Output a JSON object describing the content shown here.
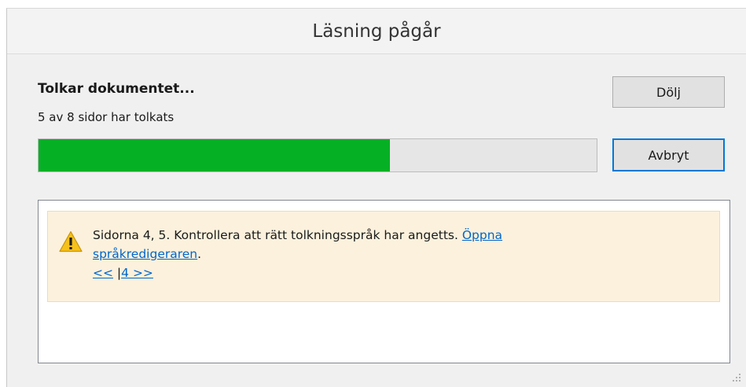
{
  "window": {
    "title": "Läsning pågår"
  },
  "status": {
    "heading": "Tolkar dokumentet...",
    "detail": "5 av 8 sidor har tolkats",
    "progress_fraction": 0.63,
    "progress_color": "#06b025"
  },
  "buttons": {
    "hide_label": "Dölj",
    "cancel_label": "Avbryt"
  },
  "log": {
    "warning": {
      "icon": "warning-icon",
      "message": "Sidorna 4, 5. Kontrollera att rätt tolkningsspråk har angetts.",
      "link_line1": "Öppna",
      "link_line2": "språkredigeraren",
      "after_link": ".",
      "nav_prev": "<<",
      "nav_separator": "|",
      "nav_next": "4 >>"
    }
  }
}
